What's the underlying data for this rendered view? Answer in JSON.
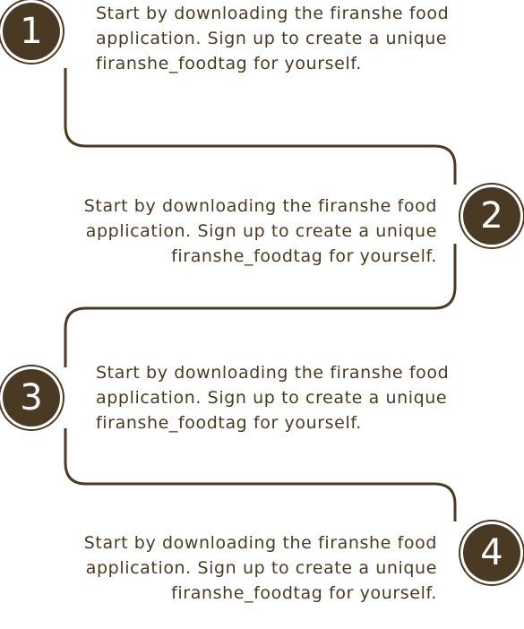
{
  "colors": {
    "accent": "#4a3a24",
    "badge_text": "#ffffff",
    "background": "#ffffff"
  },
  "steps": [
    {
      "number": "1",
      "text": "Start by downloading the firanshe food application. Sign up to create a unique firanshe_foodtag for yourself."
    },
    {
      "number": "2",
      "text": "Start by downloading the firanshe food application. Sign up to create a unique firanshe_foodtag for yourself."
    },
    {
      "number": "3",
      "text": "Start by downloading the firanshe food application. Sign up to create a unique firanshe_foodtag for yourself."
    },
    {
      "number": "4",
      "text": "Start by downloading the firanshe food application. Sign up to create a unique firanshe_foodtag for yourself."
    }
  ]
}
